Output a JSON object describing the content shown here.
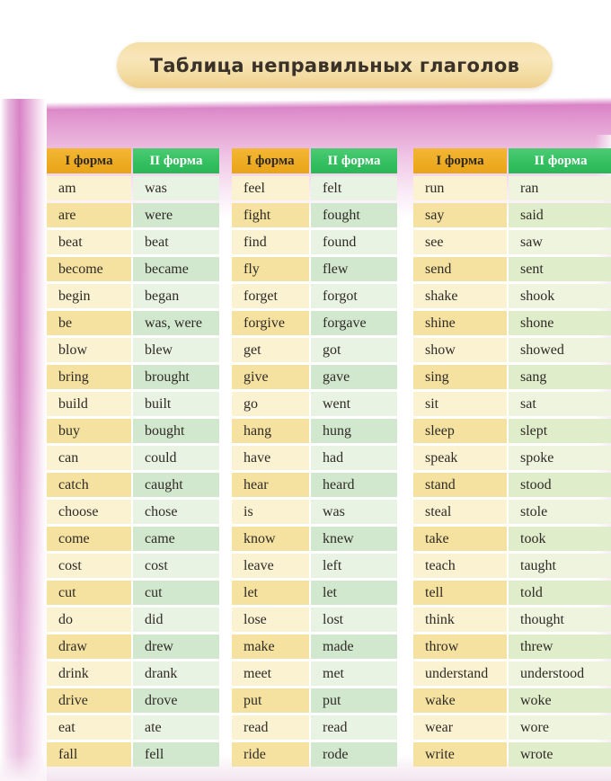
{
  "page": {
    "title": "Таблица неправильных глаголов"
  },
  "colors": {
    "header_form1_bg": "#eeab22",
    "header_form2_bg": "#33bf5f",
    "header_form1_text": "#2e2a22",
    "header_form2_text": "#ffffff",
    "cell_yellow_light": "#fbf2d2",
    "cell_yellow_dark": "#f6e2a0",
    "cell_green_light": "#e9f3e3",
    "cell_green_dark": "#d2e8ce",
    "cell_green3_light": "#eff4de",
    "cell_green3_dark": "#e0edca",
    "title_pill_bg": "#f4dda4",
    "page_accent_pink": "#d880c4"
  },
  "headers": {
    "form1": "I форма",
    "form2": "II форма"
  },
  "groups": [
    {
      "id": "group-1",
      "rows": [
        [
          "am",
          "was"
        ],
        [
          "are",
          "were"
        ],
        [
          "beat",
          "beat"
        ],
        [
          "become",
          "became"
        ],
        [
          "begin",
          "began"
        ],
        [
          "be",
          "was, were"
        ],
        [
          "blow",
          "blew"
        ],
        [
          "bring",
          "brought"
        ],
        [
          "build",
          "built"
        ],
        [
          "buy",
          "bought"
        ],
        [
          "can",
          "could"
        ],
        [
          "catch",
          "caught"
        ],
        [
          "choose",
          "chose"
        ],
        [
          "come",
          "came"
        ],
        [
          "cost",
          "cost"
        ],
        [
          "cut",
          "cut"
        ],
        [
          "do",
          "did"
        ],
        [
          "draw",
          "drew"
        ],
        [
          "drink",
          "drank"
        ],
        [
          "drive",
          "drove"
        ],
        [
          "eat",
          "ate"
        ],
        [
          "fall",
          "fell"
        ]
      ]
    },
    {
      "id": "group-2",
      "rows": [
        [
          "feel",
          "felt"
        ],
        [
          "fight",
          "fought"
        ],
        [
          "find",
          "found"
        ],
        [
          "fly",
          "flew"
        ],
        [
          "forget",
          "forgot"
        ],
        [
          "forgive",
          "forgave"
        ],
        [
          "get",
          "got"
        ],
        [
          "give",
          "gave"
        ],
        [
          "go",
          "went"
        ],
        [
          "hang",
          "hung"
        ],
        [
          "have",
          "had"
        ],
        [
          "hear",
          "heard"
        ],
        [
          "is",
          "was"
        ],
        [
          "know",
          "knew"
        ],
        [
          "leave",
          "left"
        ],
        [
          "let",
          "let"
        ],
        [
          "lose",
          "lost"
        ],
        [
          "make",
          "made"
        ],
        [
          "meet",
          "met"
        ],
        [
          "put",
          "put"
        ],
        [
          "read",
          "read"
        ],
        [
          "ride",
          "rode"
        ]
      ]
    },
    {
      "id": "group-3",
      "rows": [
        [
          "run",
          "ran"
        ],
        [
          "say",
          "said"
        ],
        [
          "see",
          "saw"
        ],
        [
          "send",
          "sent"
        ],
        [
          "shake",
          "shook"
        ],
        [
          "shine",
          "shone"
        ],
        [
          "show",
          "showed"
        ],
        [
          "sing",
          "sang"
        ],
        [
          "sit",
          "sat"
        ],
        [
          "sleep",
          "slept"
        ],
        [
          "speak",
          "spoke"
        ],
        [
          "stand",
          "stood"
        ],
        [
          "steal",
          "stole"
        ],
        [
          "take",
          "took"
        ],
        [
          "teach",
          "taught"
        ],
        [
          "tell",
          "told"
        ],
        [
          "think",
          "thought"
        ],
        [
          "throw",
          "threw"
        ],
        [
          "understand",
          "understood"
        ],
        [
          "wake",
          "woke"
        ],
        [
          "wear",
          "wore"
        ],
        [
          "write",
          "wrote"
        ]
      ]
    }
  ]
}
